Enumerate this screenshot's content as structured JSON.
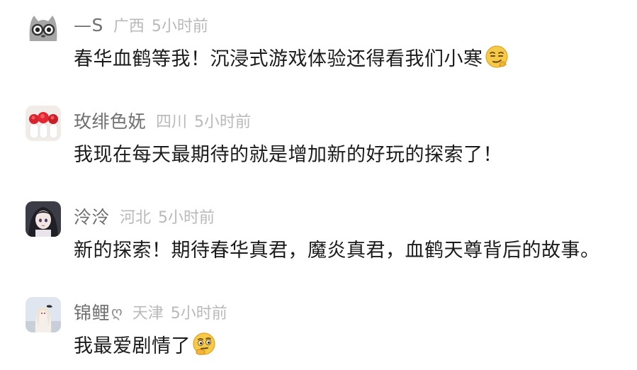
{
  "comments": [
    {
      "username": "—S",
      "location": "广西",
      "time": "5小时前",
      "content": "春华血鹤等我！沉浸式游戏体验还得看我们小寒",
      "emoji": "smirk-emoji-icon"
    },
    {
      "username": "玫绯色妩",
      "location": "四川",
      "time": "5小时前",
      "content": "我现在每天最期待的就是增加新的好玩的探索了！"
    },
    {
      "username": "泠泠",
      "location": "河北",
      "time": "5小时前",
      "content": "新的探索！期待春华真君，魔炎真君，血鹤天尊背后的故事。"
    },
    {
      "username": "锦鲤",
      "username_icon": "ღ",
      "location": "天津",
      "time": "5小时前",
      "content": "我最爱剧情了",
      "emoji": "thinking-emoji-icon"
    }
  ],
  "colors": {
    "username": "#6f6f6f",
    "meta": "#b9b9b9",
    "content": "#1b1b1b"
  }
}
